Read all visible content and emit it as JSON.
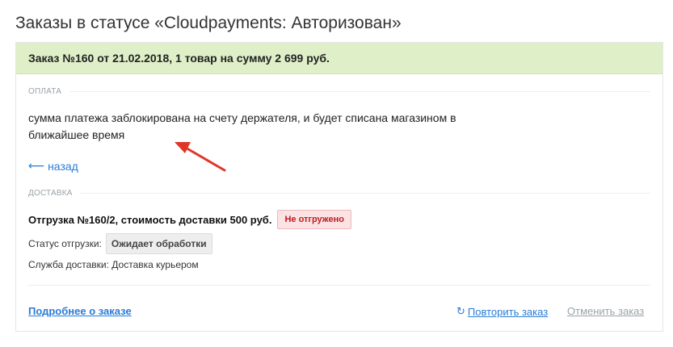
{
  "page": {
    "title": "Заказы в статусе «Cloudpayments: Авторизован»"
  },
  "order": {
    "header": "Заказ №160 от 21.02.2018, 1 товар на сумму 2 699 руб.",
    "payment": {
      "section_label": "ОПЛАТА",
      "text": "сумма платежа заблокирована на счету держателя, и будет списана магазином в ближайшее время"
    },
    "back_link": "назад",
    "delivery": {
      "section_label": "ДОСТАВКА",
      "shipment_title": "Отгрузка №160/2, стоимость доставки 500 руб.",
      "shipment_badge": "Не отгружено",
      "status_label": "Статус отгрузки:",
      "status_value": "Ожидает обработки",
      "service_text": "Служба доставки: Доставка курьером"
    },
    "actions": {
      "details": "Подробнее о заказе",
      "repeat": "Повторить заказ",
      "cancel": "Отменить заказ"
    }
  },
  "colors": {
    "header_bg": "#dff0c8",
    "link": "#2a7bd6",
    "badge_red": "#c01a22",
    "arrow": "#e0362a"
  },
  "icons": {
    "back": "left-arrow-icon",
    "repeat": "refresh-icon",
    "annotation": "red-pointer-arrow"
  }
}
